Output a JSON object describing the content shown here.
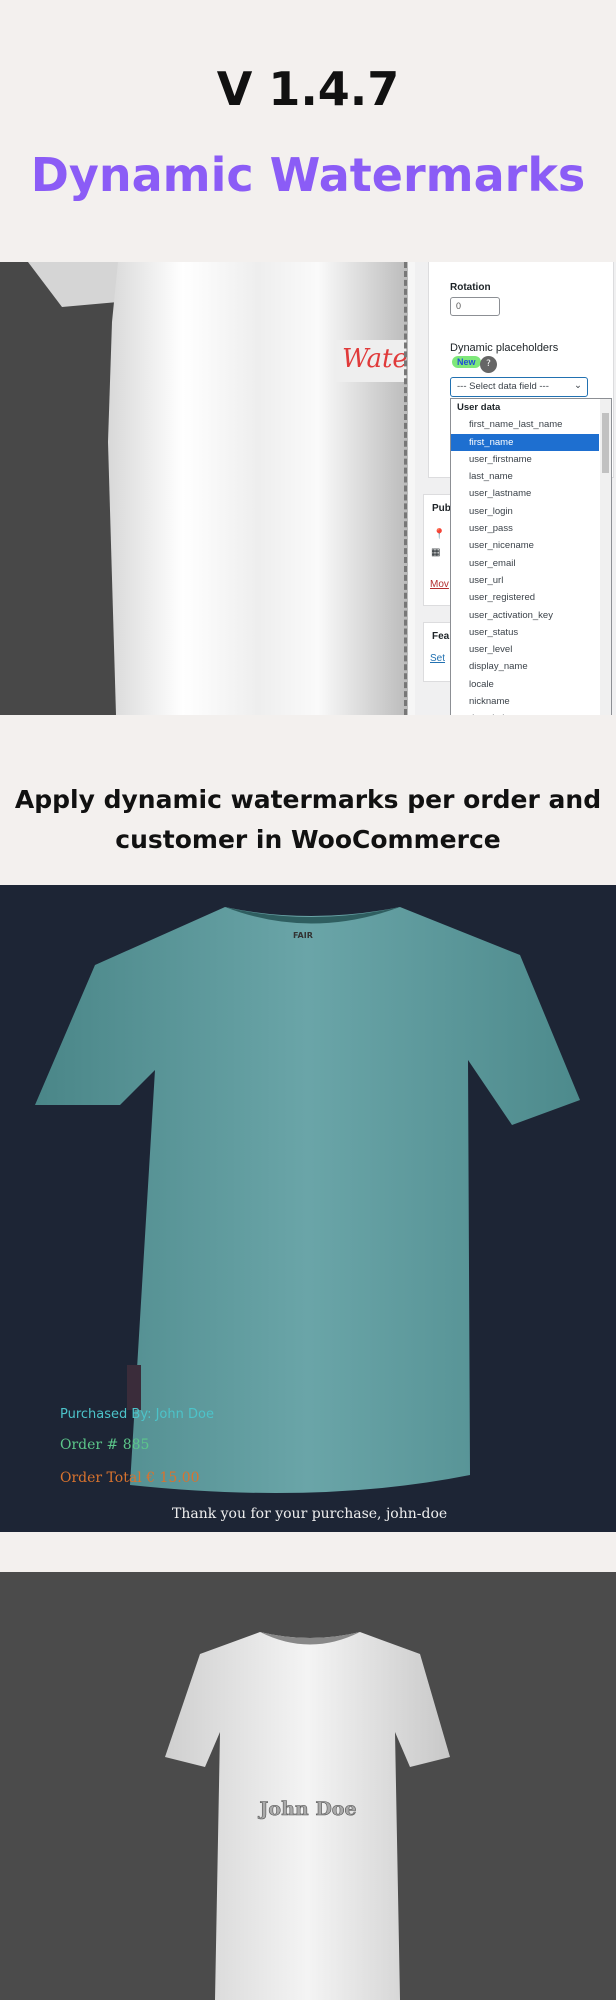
{
  "header": {
    "version": "V 1.4.7",
    "title": "Dynamic Watermarks"
  },
  "screenshot": {
    "watermark_sample": "Water",
    "rotation_label": "Rotation",
    "rotation_value": "0",
    "placeholders_label": "Dynamic placeholders",
    "new_badge": "New",
    "help": "?",
    "select_placeholder": "--- Select data field ---",
    "group_label": "User data",
    "options": [
      "first_name_last_name",
      "first_name",
      "user_firstname",
      "last_name",
      "user_lastname",
      "user_login",
      "user_pass",
      "user_nicename",
      "user_email",
      "user_url",
      "user_registered",
      "user_activation_key",
      "user_status",
      "user_level",
      "display_name",
      "locale",
      "nickname",
      "description"
    ],
    "selected_option": "first_name",
    "side_labels": {
      "publish": "Pub",
      "move": "Mov",
      "featured": "Fea",
      "set": "Set"
    }
  },
  "tagline": {
    "line1": "Apply dynamic watermarks per order and",
    "line2": "customer in WooCommerce"
  },
  "order_demo": {
    "purchased_by": "Purchased By:  John Doe",
    "order_no": "Order # 885",
    "order_total": "Order Total € 15.00",
    "thanks": "Thank you for your purchase,  john-doe",
    "brand_tag": "FAIR"
  },
  "name_demo": {
    "name": "John Doe"
  },
  "colors": {
    "accent": "#8b5cf6",
    "highlight": "#1e6fd0",
    "teal_text": "#4cc3c9",
    "green_text": "#5cc78a",
    "orange_text": "#d9732e",
    "badge": "#7ee87a"
  }
}
